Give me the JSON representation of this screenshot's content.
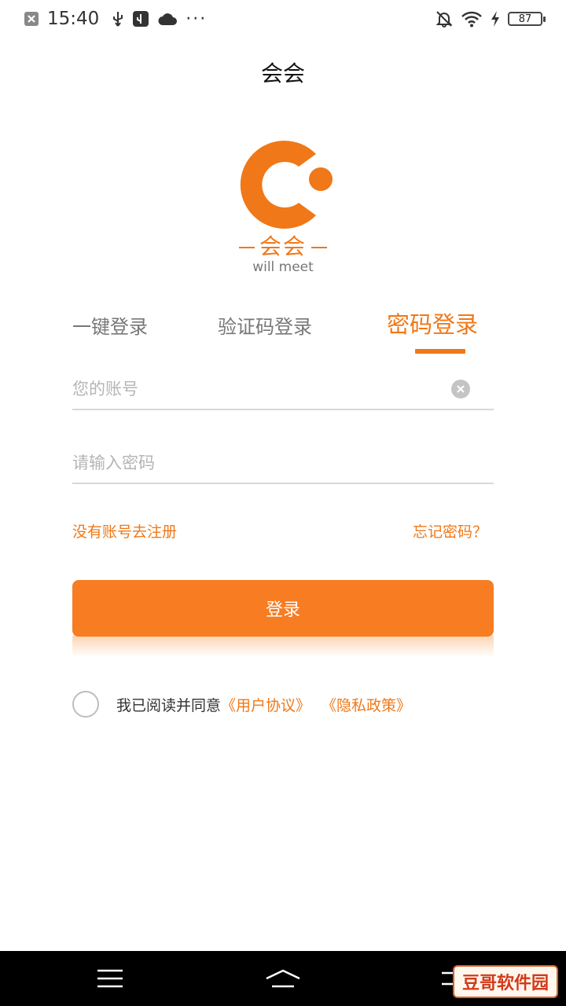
{
  "status_bar": {
    "time": "15:40",
    "battery": "87",
    "more": "···",
    "icons": [
      "close-notification-icon",
      "usb-icon",
      "usb-debug-icon",
      "cloud-icon",
      "mute-bell-icon",
      "wifi-icon",
      "charging-icon",
      "battery-icon"
    ]
  },
  "header": {
    "title": "会会"
  },
  "logo": {
    "name": "会会",
    "slogan": "will meet",
    "color": "#f07818"
  },
  "tabs": [
    {
      "label": "一键登录"
    },
    {
      "label": "验证码登录"
    },
    {
      "label": "密码登录",
      "active": true
    }
  ],
  "form": {
    "account_placeholder": "您的账号",
    "password_placeholder": "请输入密码",
    "register_link": "没有账号去注册",
    "forgot_link": "忘记密码？",
    "login_button": "登录"
  },
  "agreement": {
    "text": "我已阅读并同意",
    "user_agreement": "《用户协议》",
    "privacy_policy": "《隐私政策》",
    "checked": false
  },
  "nav_bar": {
    "buttons": [
      "menu-icon",
      "home-icon",
      "back-icon"
    ]
  },
  "watermark": {
    "text": "豆哥软件园"
  },
  "colors": {
    "accent": "#f07818",
    "button": "#f77c22"
  }
}
